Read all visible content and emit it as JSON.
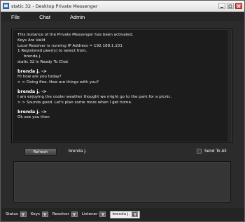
{
  "window": {
    "title": "static 32 - Desktop Private Messenger"
  },
  "menu": [
    {
      "label": "File"
    },
    {
      "label": "Chat"
    },
    {
      "label": "Admin"
    }
  ],
  "chat_log": [
    {
      "text": "This instance of the Private Messenger has been activated.",
      "kind": "system"
    },
    {
      "text": "Keys Are Valid",
      "kind": "system"
    },
    {
      "text": "Local Resolver is running IP Address = 192.168.1.101",
      "kind": "system"
    },
    {
      "text": "1 Registered peer(s) to select from.",
      "kind": "system"
    },
    {
      "text": "brenda j.",
      "kind": "indent"
    },
    {
      "text": "static 32 Is Ready To Chat",
      "kind": "system"
    },
    {
      "text": "",
      "kind": "gap"
    },
    {
      "text": "brenda j. ->",
      "kind": "sender"
    },
    {
      "text": "Hi how are you today?",
      "kind": "message"
    },
    {
      "text": "> > Doing fine. How are things with you?",
      "kind": "message"
    },
    {
      "text": "",
      "kind": "gap"
    },
    {
      "text": "brenda j. ->",
      "kind": "sender"
    },
    {
      "text": "I am enjoying the cooler weather thought we might go to the park for a picnic.",
      "kind": "message"
    },
    {
      "text": "> > Sounds good. Let's plan some more when I get home.",
      "kind": "message"
    },
    {
      "text": "",
      "kind": "gap"
    },
    {
      "text": "brenda j. ->",
      "kind": "sender"
    },
    {
      "text": "Ok see you then",
      "kind": "message"
    }
  ],
  "controls": {
    "refresh_label": "Refresh",
    "selected_peer": "brenda j.",
    "send_to_all_label": "Send To All",
    "send_to_all_checked": false
  },
  "status_bar": [
    {
      "label": "Status",
      "active": false
    },
    {
      "label": "Keys",
      "active": false
    },
    {
      "label": "Resolver",
      "active": false
    },
    {
      "label": "Listener",
      "active": false
    },
    {
      "label": "brenda j.",
      "active": true
    }
  ],
  "colors": {
    "window_bg": "#2b2b2b",
    "chat_bg": "#1c1c1c",
    "input_bg": "#353535",
    "text": "#ececec"
  }
}
